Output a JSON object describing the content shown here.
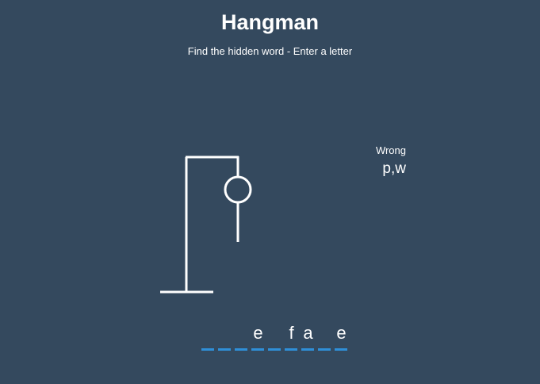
{
  "header": {
    "title": "Hangman",
    "subtitle": "Find the hidden word - Enter a letter"
  },
  "wrong": {
    "label": "Wrong",
    "letters": "p,w"
  },
  "word": {
    "slots": [
      "",
      "",
      "",
      "e",
      "",
      "f",
      "a",
      "",
      "e"
    ]
  },
  "hangman": {
    "parts_shown": [
      "gallows-base",
      "gallows-pole",
      "gallows-beam",
      "rope",
      "head",
      "body"
    ]
  },
  "colors": {
    "background": "#34495e",
    "slot_underline": "#2f8fd8",
    "text": "#ffffff"
  }
}
